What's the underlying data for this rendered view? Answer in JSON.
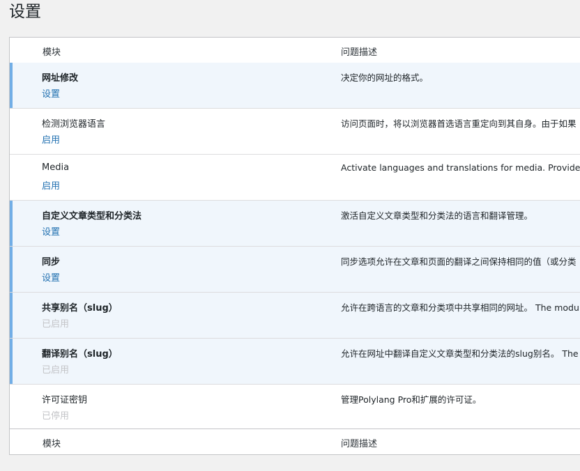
{
  "page": {
    "title": "设置"
  },
  "table": {
    "header": {
      "module": "模块",
      "description": "问题描述"
    },
    "footer": {
      "module": "模块",
      "description": "问题描述"
    },
    "rows": [
      {
        "name": "网址修改",
        "action": "设置",
        "description": "决定你的网址的格式。",
        "active": true,
        "action_enabled": true
      },
      {
        "name": "检测浏览器语言",
        "action": "启用",
        "description": "访问页面时，将以浏览器首选语言重定向到其自身。由于如果",
        "active": false,
        "action_enabled": true
      },
      {
        "name": "Media",
        "action": "启用",
        "description": "Activate languages and translations for media. Provides opti",
        "active": false,
        "action_enabled": true
      },
      {
        "name": "自定义文章类型和分类法",
        "action": "设置",
        "description": "激活自定义文章类型和分类法的语言和翻译管理。",
        "active": true,
        "action_enabled": true
      },
      {
        "name": "同步",
        "action": "设置",
        "description": "同步选项允许在文章和页面的翻译之间保持相同的值（或分类",
        "active": true,
        "action_enabled": true
      },
      {
        "name": "共享别名（slug）",
        "action": "已启用",
        "description": "允许在跨语言的文章和分类项中共享相同的网址。 The modu",
        "active": true,
        "action_enabled": false
      },
      {
        "name": "翻译别名（slug）",
        "action": "已启用",
        "description": "允许在网址中翻译自定义文章类型和分类法的slug别名。 The",
        "active": true,
        "action_enabled": false
      },
      {
        "name": "许可证密钥",
        "action": "已停用",
        "description": "管理Polylang Pro和扩展的许可证。",
        "active": false,
        "action_enabled": false
      }
    ]
  }
}
